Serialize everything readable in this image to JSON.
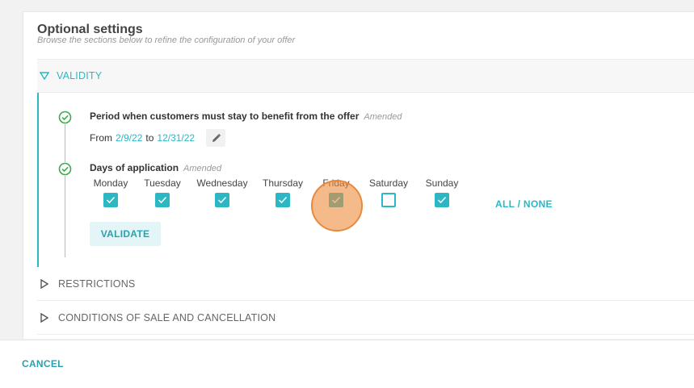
{
  "panel": {
    "title": "Optional settings",
    "subtitle": "Browse the sections below to refine the configuration of your offer"
  },
  "sections": {
    "validity": "VALIDITY",
    "restrictions": "RESTRICTIONS",
    "conditions": "CONDITIONS OF SALE AND CANCELLATION"
  },
  "period": {
    "title": "Period when customers must stay to benefit from the offer",
    "status": "Amended",
    "from_label": "From",
    "from_date": "2/9/22",
    "to_label": "to",
    "to_date": "12/31/22"
  },
  "days": {
    "title": "Days of application",
    "status": "Amended",
    "items": [
      {
        "name": "Monday",
        "checked": true
      },
      {
        "name": "Tuesday",
        "checked": true
      },
      {
        "name": "Wednesday",
        "checked": true
      },
      {
        "name": "Thursday",
        "checked": true
      },
      {
        "name": "Friday",
        "checked": true
      },
      {
        "name": "Saturday",
        "checked": false
      },
      {
        "name": "Sunday",
        "checked": true
      }
    ],
    "all_none": "ALL / NONE"
  },
  "buttons": {
    "validate": "VALIDATE",
    "cancel": "CANCEL"
  },
  "colors": {
    "accent": "#2bb7c4",
    "highlight": "#e8893b"
  }
}
